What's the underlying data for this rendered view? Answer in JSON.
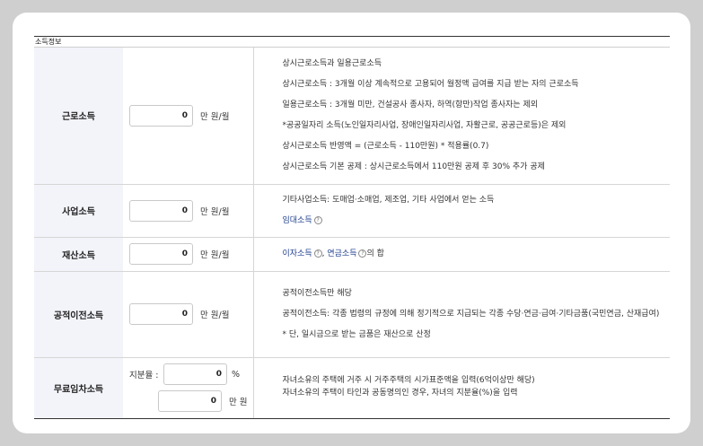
{
  "section_title": "소득정보",
  "rows": {
    "earned": {
      "label": "근로소득",
      "value": "0",
      "unit": "만 원/월",
      "desc": [
        "상시근로소득과 일용근로소득",
        "상시근로소득 : 3개월 이상 계속적으로 고용되어 월정액 급여를 지급 받는 자의 근로소득",
        "일용근로소득 : 3개월 미만, 건설공사 종사자, 하역(항만)작업 종사자는 제외",
        "*공공일자리 소득(노인일자리사업, 장애인일자리사업, 자활근로, 공공근로등)은 제외",
        "상시근로소득 반영액 = (근로소득 - 110만원) * 적용률(0.7)",
        "상시근로소득 기본 공제 : 상시근로소득에서 110만원 공제 후 30% 추가 공제"
      ]
    },
    "business": {
      "label": "사업소득",
      "value": "0",
      "unit": "만 원/월",
      "desc": "기타사업소득: 도매업·소매업, 제조업, 기타 사업에서 얻는 소득",
      "link": "임대소득"
    },
    "property": {
      "label": "재산소득",
      "value": "0",
      "unit": "만 원/월",
      "link1": "이자소득",
      "sep": ", ",
      "link2": "연금소득",
      "suffix": "의 합"
    },
    "transfer": {
      "label": "공적이전소득",
      "value": "0",
      "unit": "만 원/월",
      "desc": [
        "공적이전소득만 해당",
        "공적이전소득: 각종 법령의 규정에 의해 정기적으로 지급되는 각종 수당·연금·급여·기타금품(국민연금, 산재급여)",
        "* 단, 일시금으로 받는 금품은 재산으로 산정"
      ]
    },
    "rent_free": {
      "label": "무료임차소득",
      "share_label": "지분율 :",
      "share_value": "0",
      "share_unit": "%",
      "amount_value": "0",
      "amount_unit": "만 원",
      "desc": [
        "자녀소유의 주택에 거주 시 거주주택의 시가표준액을 입력(6억이상만 해당)",
        "자녀소유의 주택이 타인과 공동명의인 경우, 자녀의 지분율(%)을 입력"
      ]
    }
  },
  "help_icon_glyph": "?"
}
